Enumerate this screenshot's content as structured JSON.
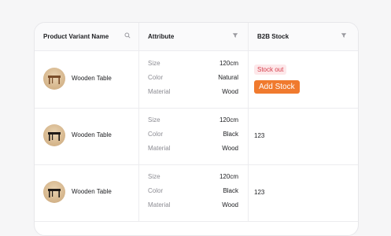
{
  "table": {
    "headers": {
      "product_variant_name": "Product Variant Name",
      "attribute": "Attribute",
      "b2b_stock": "B2B Stock"
    },
    "rows": [
      {
        "name": "Wooden Table",
        "table_color": "#7a4e2b",
        "attributes": [
          {
            "key": "Size",
            "value": "120cm"
          },
          {
            "key": "Color",
            "value": "Natural"
          },
          {
            "key": "Material",
            "value": "Wood"
          }
        ],
        "stock_badge": "Stock out",
        "stock_action": "Add Stock"
      },
      {
        "name": "Wooden Table",
        "table_color": "#1f1a17",
        "attributes": [
          {
            "key": "Size",
            "value": "120cm"
          },
          {
            "key": "Color",
            "value": "Black"
          },
          {
            "key": "Material",
            "value": "Wood"
          }
        ],
        "stock": "123"
      },
      {
        "name": "Wooden Table",
        "table_color": "#1f1a17",
        "attributes": [
          {
            "key": "Size",
            "value": "120cm"
          },
          {
            "key": "Color",
            "value": "Black"
          },
          {
            "key": "Material",
            "value": "Wood"
          }
        ],
        "stock": "123"
      }
    ]
  },
  "colors": {
    "accent": "#f07a2e",
    "danger_text": "#d53c4a",
    "danger_bg": "#fde8ea"
  }
}
